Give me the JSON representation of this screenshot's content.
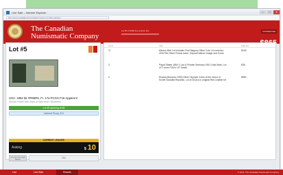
{
  "browser": {
    "window_title": "Live Sale – Internet Explorer",
    "url": "http://www.canadiannumismaticcompany.com/live-auction"
  },
  "header": {
    "brand_line1": "The Canadian",
    "brand_line2": "Numismatic Company",
    "sale_note": "Lot #5 of 2000 live auction lots",
    "account_badge": "CONNECTED",
    "amount": "$865"
  },
  "lot": {
    "title": "Lot #5",
    "description": "USA: 1862 $1 #R55R6, Fr. 17a PCGS F15 Apparent",
    "sub_description": "Shows Powell with Stars at right lower. Bicolored.",
    "opening": "Lot #5 opening at $5",
    "proxy": "Internet Proxy: $ 5",
    "leader_label": "CURRENT LEADER!",
    "ask_label": "Asking",
    "ask_currency": "$",
    "ask_value": "10",
    "bid_button": "You Are The High Bidder",
    "secondary_button": "Bid"
  },
  "results_table": {
    "columns": [
      "Lot #",
      "Title",
      "Sold For"
    ],
    "rows": [
      {
        "num": "*2",
        "title": "Mexico Mint Lot includes First Maguey Silver Coin 10 comedor, 20th Film Silver Round issue. Deposit Waiver Image and Coins",
        "sold": "$245"
      },
      {
        "num": "3",
        "title": "Papal States 1864 1 Lira & Private Germany 1901 Gold Mark, Lot of 2 coins FVA to VF Grade",
        "sold": "$35"
      },
      {
        "num": "4",
        "title": "Russia (Moscow 1992) Silver Olympic Coins of the Union of Soviet Socialist Republic, Lot of 28 pcs in original Red Leather kit",
        "sold": "$550"
      }
    ]
  },
  "footer": {
    "tabs": [
      "Live",
      "Live Bids",
      "Results"
    ],
    "copyright": "© 2014, The Canadian Numismatic Company"
  },
  "colors": {
    "brand_red": "#c21b1b",
    "accent_green": "#4aa23b",
    "leader_yellow": "#e9b21a"
  }
}
